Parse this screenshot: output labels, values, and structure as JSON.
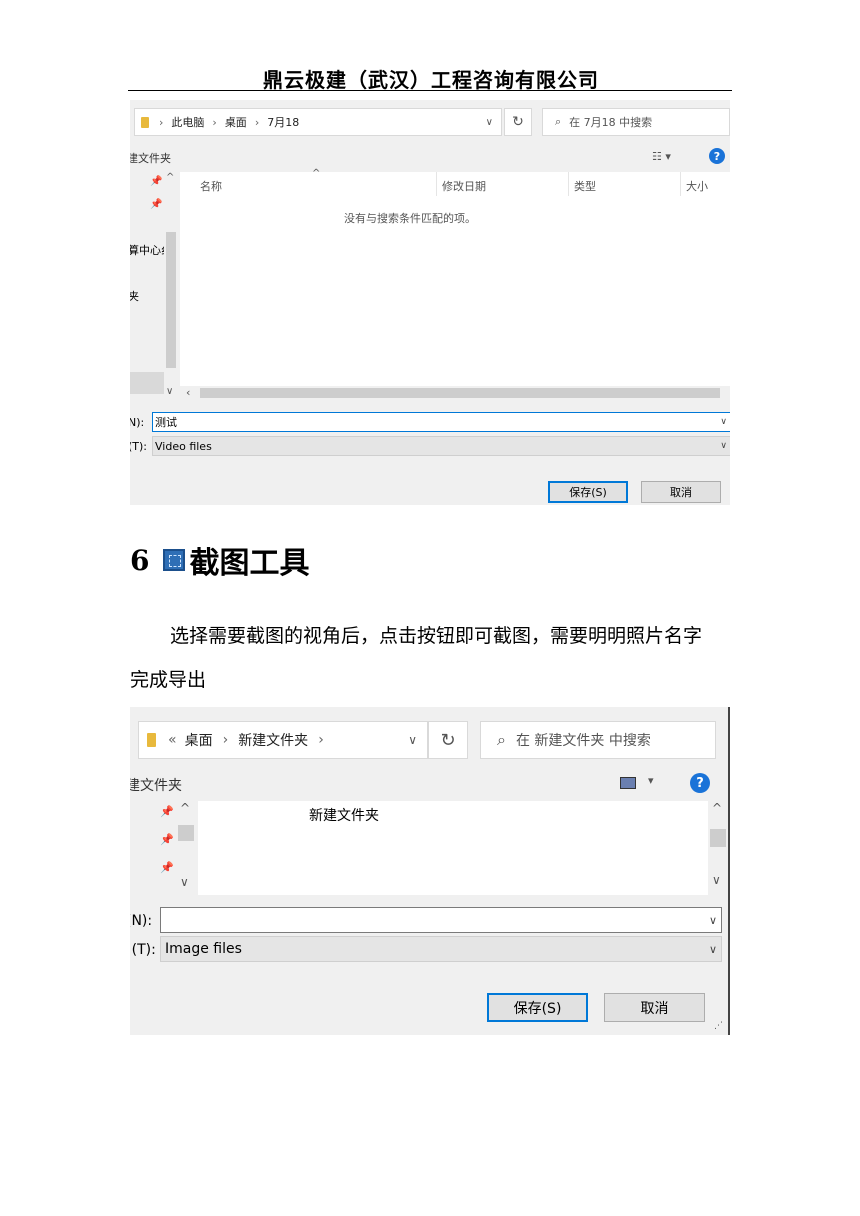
{
  "header": {
    "company": "鼎云极建（武汉）工程咨询有限公司"
  },
  "dialog1": {
    "breadcrumb": [
      "此电脑",
      "桌面",
      "7月18"
    ],
    "search_placeholder": "在 7月18 中搜索",
    "new_folder": "建文件夹",
    "columns": [
      "名称",
      "修改日期",
      "类型",
      "大小"
    ],
    "empty_message": "没有与搜索条件匹配的项。",
    "nav_items": [
      "算中心纟",
      "夹"
    ],
    "filename_label": "N):",
    "filename_value": "测试",
    "filetype_label": "(T):",
    "filetype_value": "Video files",
    "save_button": "保存(S)",
    "cancel_button": "取消"
  },
  "section": {
    "number": "6",
    "title": "截图工具"
  },
  "paragraph": {
    "line1": "选择需要截图的视角后，点击按钮即可截图，需要明明照片名字",
    "line2": "完成导出"
  },
  "dialog2": {
    "breadcrumb_prefix": "«",
    "breadcrumb": [
      "桌面",
      "新建文件夹"
    ],
    "search_placeholder": "在 新建文件夹 中搜索",
    "new_folder": "建文件夹",
    "list_item": "新建文件夹",
    "filename_label": "(N):",
    "filename_value": "",
    "filetype_label": "!(T):",
    "filetype_value": "Image files",
    "save_button": "保存(S)",
    "cancel_button": "取消"
  }
}
